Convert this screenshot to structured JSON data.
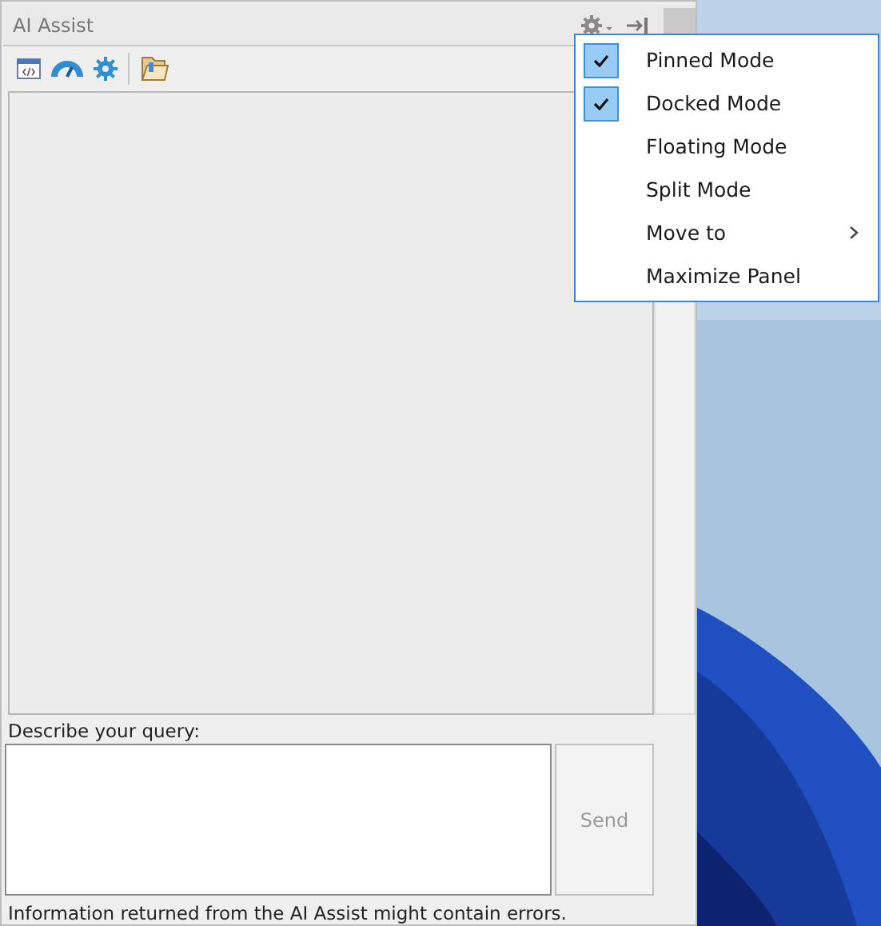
{
  "panel": {
    "title": "AI Assist"
  },
  "query": {
    "label": "Describe your query:",
    "send": "Send",
    "send_disabled": true
  },
  "disclaimer": "Information returned from the AI Assist might contain errors.",
  "menu": [
    {
      "label": "Pinned Mode",
      "checked": true,
      "submenu": false
    },
    {
      "label": "Docked Mode",
      "checked": true,
      "submenu": false
    },
    {
      "label": "Floating Mode",
      "checked": false,
      "submenu": false
    },
    {
      "label": "Split Mode",
      "checked": false,
      "submenu": false
    },
    {
      "label": "Move to",
      "checked": false,
      "submenu": true
    },
    {
      "label": "Maximize Panel",
      "checked": false,
      "submenu": false
    }
  ]
}
